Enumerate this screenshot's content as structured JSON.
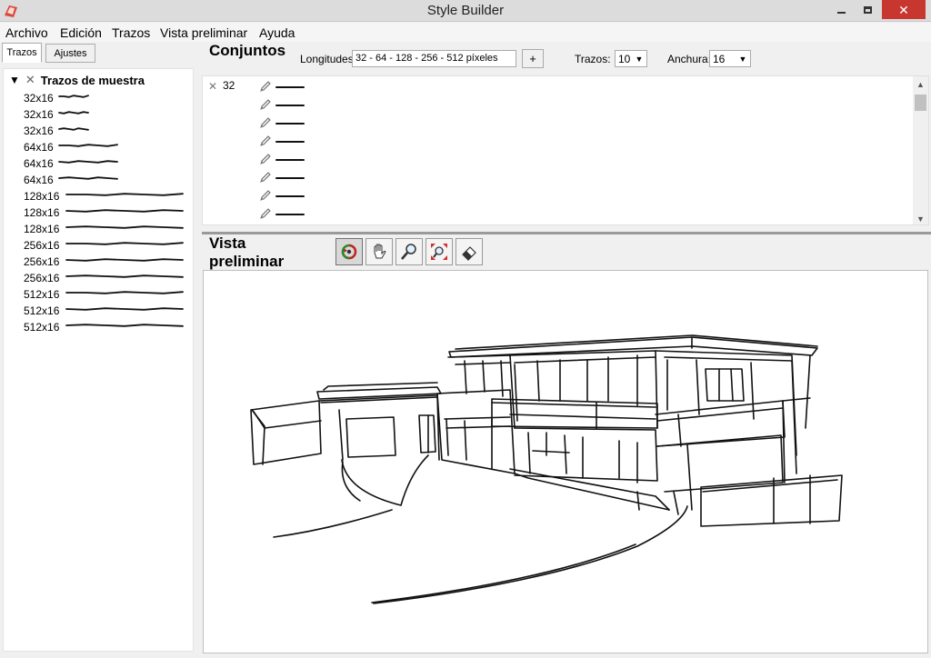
{
  "window": {
    "title": "Style Builder"
  },
  "menu": [
    "Archivo",
    "Edición",
    "Trazos",
    "Vista preliminar",
    "Ayuda"
  ],
  "tabs": [
    "Trazos",
    "Ajustes"
  ],
  "tree": {
    "header": "Trazos de muestra",
    "items": [
      "32x16",
      "32x16",
      "32x16",
      "64x16",
      "64x16",
      "64x16",
      "128x16",
      "128x16",
      "128x16",
      "256x16",
      "256x16",
      "256x16",
      "512x16",
      "512x16",
      "512x16"
    ]
  },
  "sets": {
    "title": "Conjuntos",
    "longitudes_label": "Longitudes:",
    "longitudes_value": "32 - 64 - 128 - 256 - 512 píxeles",
    "add_label": "+",
    "trazos_label": "Trazos:",
    "trazos_value": "10",
    "anchura_label": "Anchura:",
    "anchura_value": "16",
    "first_set": "32"
  },
  "preview": {
    "title": "Vista preliminar",
    "tools": [
      "orbit-icon",
      "pan-icon",
      "zoom-icon",
      "zoom-extents-icon",
      "eraser-icon"
    ]
  },
  "colors": {
    "close_button": "#c7372f",
    "splitter": "#9a9a9a"
  }
}
